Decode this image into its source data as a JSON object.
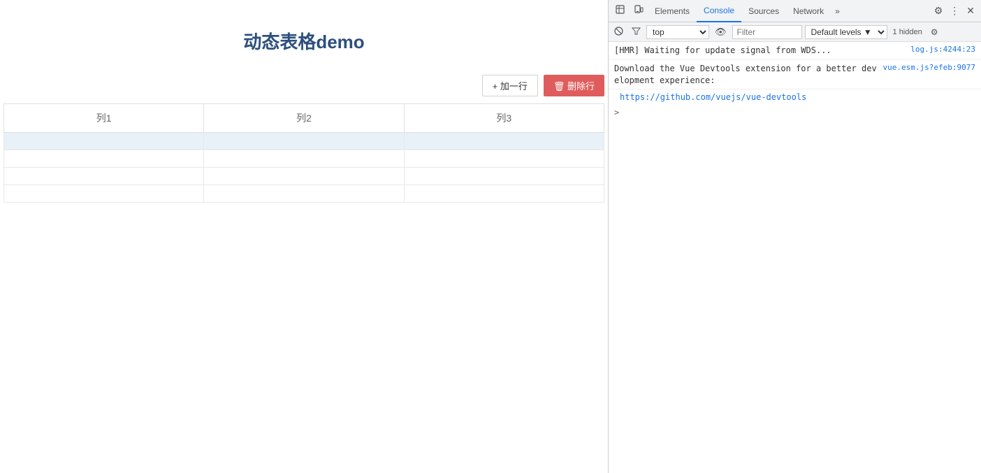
{
  "app": {
    "title": "动态表格demo",
    "buttons": {
      "add_row": "+ 加一行",
      "delete_row": "🗑 删除行"
    },
    "table": {
      "columns": [
        "列1",
        "列2",
        "列3"
      ],
      "rows": [
        [
          "",
          "",
          ""
        ],
        [
          "",
          "",
          ""
        ],
        [
          "",
          "",
          ""
        ],
        [
          "",
          "",
          ""
        ]
      ]
    }
  },
  "devtools": {
    "tabs": [
      {
        "label": "Elements",
        "active": false
      },
      {
        "label": "Console",
        "active": true
      },
      {
        "label": "Sources",
        "active": false
      },
      {
        "label": "Network",
        "active": false
      }
    ],
    "more_label": "»",
    "console": {
      "context_value": "top",
      "filter_placeholder": "Filter",
      "level_label": "Default levels ▼",
      "hidden_count": "1 hidden",
      "logs": [
        {
          "text": "[HMR] Waiting for update signal from WDS...",
          "link_text": "log.js:4244:23",
          "link_href": "#"
        },
        {
          "text": "Download the Vue Devtools extension for a better development experience:\nhttps://github.com/vuejs/vue-devtools",
          "link_text": "vue.esm.js?efeb:9077",
          "link_href": "#"
        }
      ],
      "vue_devtools_url": "https://github.com/vuejs/vue-devtools",
      "prompt_symbol": ">"
    }
  }
}
